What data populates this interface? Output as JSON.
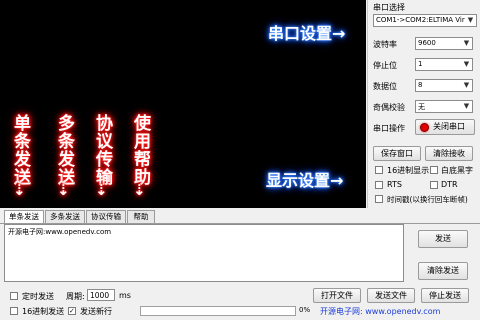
{
  "receive_area": {
    "annotations": {
      "single_send": "单条发送",
      "multi_send": "多条发送",
      "protocol": "协议传输",
      "help": "使用帮助",
      "port_settings": "串口设置",
      "display_settings": "显示设置"
    }
  },
  "panel": {
    "port_select_label": "串口选择",
    "port_value": "COM1->COM2:ELTIMA Vir",
    "baud_label": "波特率",
    "baud_value": "9600",
    "stop_label": "停止位",
    "stop_value": "1",
    "data_label": "数据位",
    "data_value": "8",
    "parity_label": "奇偶校验",
    "parity_value": "无",
    "op_label": "串口操作",
    "close_port_label": "关闭串口",
    "save_window_label": "保存窗口",
    "clear_receive_label": "清除接收",
    "hex_display_label": "16进制显示",
    "white_bg_label": "白底黑字",
    "rts_label": "RTS",
    "dtr_label": "DTR",
    "timestamp_label": "时间戳(以换行回车断帧)"
  },
  "tabs": [
    {
      "label": "单条发送"
    },
    {
      "label": "多条发送"
    },
    {
      "label": "协议传输"
    },
    {
      "label": "帮助"
    }
  ],
  "send": {
    "text": "开源电子网:www.openedv.com",
    "send_button": "发送",
    "clear_send_button": "清除发送"
  },
  "bottom": {
    "timed_send_label": "定时发送",
    "period_label": "周期:",
    "period_value": "1000",
    "period_unit": "ms",
    "open_file_button": "打开文件",
    "send_file_button": "发送文件",
    "stop_send_button": "停止发送",
    "hex_send_label": "16进制发送",
    "newline_label": "发送新行",
    "progress_text": "0%",
    "progress_value": 0,
    "footer_link": "开源电子网: www.openedv.com"
  },
  "colors": {
    "receive_bg": "#000000",
    "glow_red": "#ff0000",
    "glow_blue": "#1a5cff",
    "link_blue": "#1a3cd8",
    "close_port_indicator": "#e00000"
  }
}
